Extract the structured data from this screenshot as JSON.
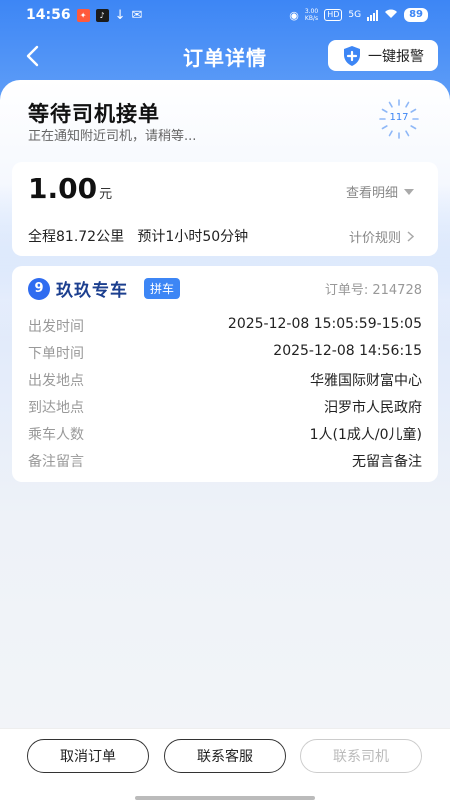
{
  "status_bar": {
    "time": "14:56",
    "speed": "3.00",
    "speed_unit": "KB/s",
    "hd_label": "HD",
    "network": "5G",
    "battery": "89"
  },
  "nav": {
    "title": "订单详情",
    "sos_label": "一键报警"
  },
  "status": {
    "title": "等待司机接单",
    "subtitle": "正在通知附近司机，请稍等...",
    "countdown": "117"
  },
  "price": {
    "amount": "1.00",
    "unit": "元",
    "detail_link": "查看明细",
    "summary": "全程81.72公里   预计1小时50分钟",
    "rules_link": "计价规则"
  },
  "order": {
    "brand": "玖玖专车",
    "tag": "拼车",
    "order_no": "订单号: 214728",
    "rows": [
      {
        "label": "出发时间",
        "value": "2025-12-08 15:05:59-15:05"
      },
      {
        "label": "下单时间",
        "value": "2025-12-08 14:56:15"
      },
      {
        "label": "出发地点",
        "value": "华雅国际财富中心"
      },
      {
        "label": "到达地点",
        "value": "汨罗市人民政府"
      },
      {
        "label": "乘车人数",
        "value": "1人(1成人/0儿童)"
      },
      {
        "label": "备注留言",
        "value": "无留言备注"
      }
    ]
  },
  "actions": {
    "cancel": "取消订单",
    "service": "联系客服",
    "driver": "联系司机"
  },
  "colors": {
    "accent": "#3d86f5",
    "brand": "#1c3f8f"
  }
}
